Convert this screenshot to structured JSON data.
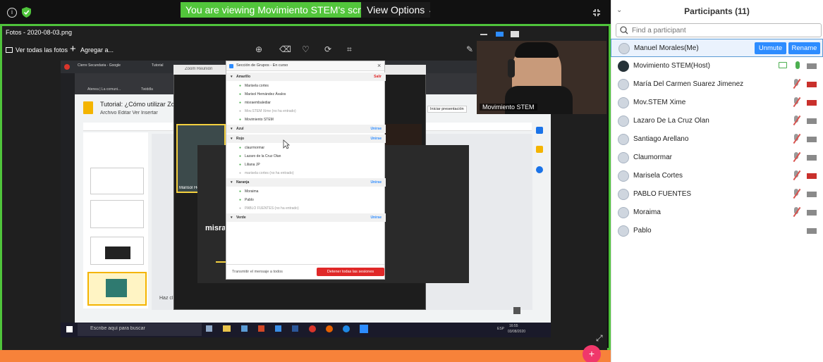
{
  "banner": {
    "text": "You are viewing Movimiento STEM's screen",
    "view_options": "View Options"
  },
  "photos": {
    "title": "Fotos - 2020-08-03.png",
    "ver_todas": "Ver todas las fotos",
    "agregar": "Agregar a..."
  },
  "doc": {
    "tab1": "Cierre Secundaria - Google",
    "tab2": "Tutorial",
    "title": "Tutorial: ¿Cómo utilizar Zo",
    "menu": "Archivo  Editar  Ver  Insertar",
    "bookmark1": "Atenea | La comuni...",
    "bookmark2": "Twiddla",
    "iniciar": "Iniciar presentación",
    "notes": "Haz cl",
    "slide_text": "misra"
  },
  "zoom_room": {
    "title": "Zoom Reunión",
    "name_tag": "Marisol Hernández A..."
  },
  "breakout": {
    "title": "Sección de Grupos - En curso",
    "groups": [
      {
        "name": "Amarillo",
        "action": "Salir",
        "members": [
          "Marisela cortes",
          "Marisol Hernández Ávalos",
          "misraembalediar",
          "Mov.STEM Xime (no ha entrado)",
          "Movimiento STEM"
        ]
      },
      {
        "name": "Azul",
        "action": "Unirse",
        "members": []
      },
      {
        "name": "Rojo",
        "action": "Unirse",
        "members": [
          "claurmormar",
          "Lazaro de la Cruz Olan",
          "Liliana JP",
          "marisela cortes (no ha entrado)"
        ]
      },
      {
        "name": "Naranja",
        "action": "Unirse",
        "members": [
          "Moraima",
          "Pablo",
          "PABLO FUENTES (no ha entrado)"
        ]
      },
      {
        "name": "Verde",
        "action": "Unirse",
        "members": []
      }
    ],
    "broadcast": "Transmitir el mensaje a todos",
    "stop": "Detener todas las sesiones"
  },
  "taskbar": {
    "search": "Escribe aquí para buscar",
    "lang": "ESP",
    "time": "16:55",
    "date": "03/08/2020"
  },
  "camera": {
    "label": "Movimiento STEM"
  },
  "participants": {
    "title": "Participants (11)",
    "search_placeholder": "Find a participant",
    "unmute_label": "Unmute",
    "rename_label": "Rename",
    "list": [
      {
        "name": "Manuel Morales(Me)"
      },
      {
        "name": "Movimiento STEM(Host)"
      },
      {
        "name": "María Del Carmen Suarez Jimenez"
      },
      {
        "name": "Mov.STEM Xime"
      },
      {
        "name": "Lazaro De La Cruz Olan"
      },
      {
        "name": "Santiago Arellano"
      },
      {
        "name": "Claumormar"
      },
      {
        "name": "Marisela Cortes"
      },
      {
        "name": "PABLO FUENTES"
      },
      {
        "name": "Moraima"
      },
      {
        "name": "Pablo"
      }
    ]
  },
  "colors": {
    "share_green": "#52c53b",
    "zoom_blue": "#2d8cff",
    "muted_red": "#d9534f",
    "orange": "#f7823a"
  }
}
